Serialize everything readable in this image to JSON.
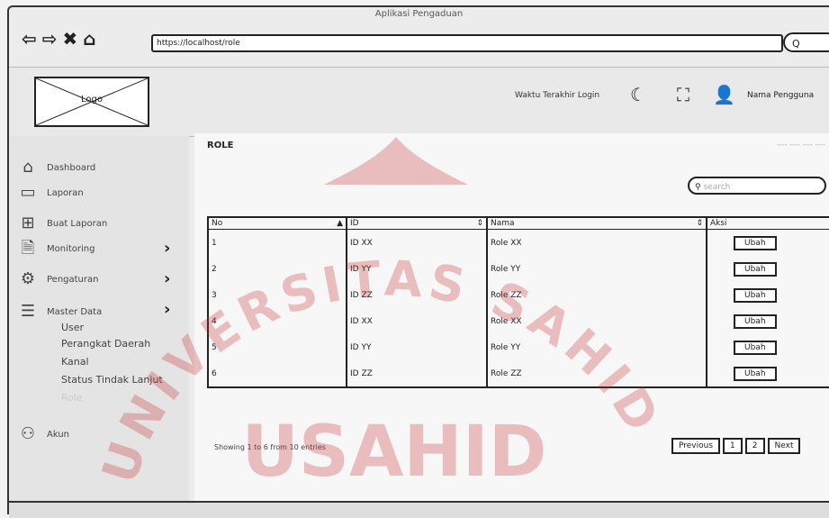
{
  "browser": {
    "title": "Aplikasi Pengaduan",
    "url": "https://localhost/role",
    "search_label": "Q"
  },
  "header": {
    "logo_label": "Logo",
    "welcome": "Waktu Terakhir Login",
    "username": "Nama Pengguna"
  },
  "sidebar": {
    "items": [
      {
        "label": "Dashboard",
        "icon": "home-icon"
      },
      {
        "label": "Laporan",
        "icon": "comment-icon"
      },
      {
        "label": "Buat Laporan",
        "icon": "plus-square-icon"
      },
      {
        "label": "Monitoring",
        "icon": "document-icon"
      },
      {
        "label": "Pengaturan",
        "icon": "gear-icon"
      },
      {
        "label": "Master Data",
        "icon": "database-icon"
      }
    ],
    "sub_items": [
      "User",
      "Perangkat Daerah",
      "Kanal",
      "Status Tindak Lanjut",
      "Role"
    ],
    "account": "Akun"
  },
  "main": {
    "title": "ROLE",
    "breadcrumb": "---- ---- ---- ----",
    "search_placeholder": "search",
    "columns": [
      "No",
      "ID",
      "Nama",
      "Aksi"
    ],
    "rows": [
      {
        "no": "1",
        "id": "ID XX",
        "nama": "Role XX",
        "aksi": "Ubah"
      },
      {
        "no": "2",
        "id": "ID YY",
        "nama": "Role YY",
        "aksi": "Ubah"
      },
      {
        "no": "3",
        "id": "ID ZZ",
        "nama": "Role ZZ",
        "aksi": "Ubah"
      },
      {
        "no": "4",
        "id": "ID XX",
        "nama": "Role XX",
        "aksi": "Ubah"
      },
      {
        "no": "5",
        "id": "ID YY",
        "nama": "Role YY",
        "aksi": "Ubah"
      },
      {
        "no": "6",
        "id": "ID ZZ",
        "nama": "Role ZZ",
        "aksi": "Ubah"
      }
    ],
    "showing": "Showing 1 to 6 from 10 entries",
    "pagination": [
      "Previous",
      "1",
      "2",
      "Next"
    ]
  },
  "watermark": {
    "arc_text": "UNIVERSITAS SAHID",
    "center_text": "USAHID",
    "color": "#c62828"
  }
}
